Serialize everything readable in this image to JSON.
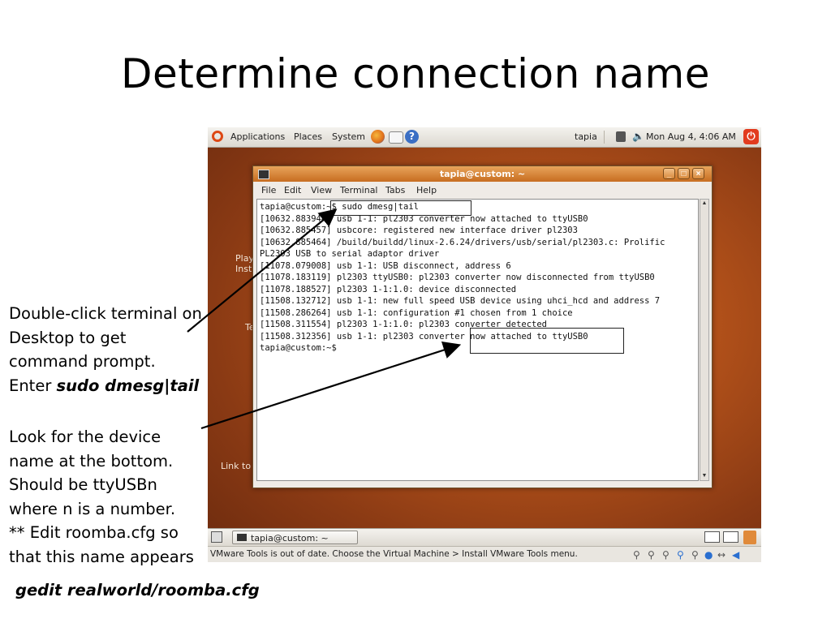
{
  "slide": {
    "title": "Determine connection name"
  },
  "top_panel": {
    "menus": [
      "Applications",
      "Places",
      "System"
    ],
    "user": "tapia",
    "clock": "Mon Aug  4,  4:06 AM",
    "icons": [
      "ubuntu-logo-icon",
      "firefox-icon",
      "mail-icon",
      "help-icon",
      "network-icon",
      "volume-icon",
      "power-icon"
    ]
  },
  "desktop": {
    "labels": [
      "Play",
      "Inst",
      "Te",
      "Link to"
    ]
  },
  "terminal": {
    "title": "tapia@custom: ~",
    "menu": [
      "File",
      "Edit",
      "View",
      "Terminal",
      "Tabs",
      "Help"
    ],
    "lines": [
      "tapia@custom:~$ sudo dmesg|tail",
      "[10632.883944] usb 1-1: pl2303 converter now attached to ttyUSB0",
      "[10632.885457] usbcore: registered new interface driver pl2303",
      "[10632.885464] /build/buildd/linux-2.6.24/drivers/usb/serial/pl2303.c: Prolific",
      "PL2303 USB to serial adaptor driver",
      "[11078.079008] usb 1-1: USB disconnect, address 6",
      "[11078.183119] pl2303 ttyUSB0: pl2303 converter now disconnected from ttyUSB0",
      "[11078.188527] pl2303 1-1:1.0: device disconnected",
      "[11508.132712] usb 1-1: new full speed USB device using uhci_hcd and address 7",
      "[11508.286264] usb 1-1: configuration #1 chosen from 1 choice",
      "[11508.311554] pl2303 1-1:1.0: pl2303 converter detected",
      "[11508.312356] usb 1-1: pl2303 converter now attached to ttyUSB0",
      "tapia@custom:~$"
    ]
  },
  "taskbar": {
    "task": "tapia@custom: ~"
  },
  "vmware": {
    "message": "VMware Tools is out of date. Choose the Virtual Machine > Install VMware Tools menu."
  },
  "annotations": {
    "note1": "Double-click terminal on\nDesktop to get\ncommand prompt.\nEnter ",
    "note1_cmd": "sudo dmesg|tail",
    "note2": "Look for the device\nname at the bottom.\nShould be ttyUSBn\nwhere n is a number.\n** Edit roomba.cfg so\nthat this name appears",
    "command": "gedit realworld/roomba.cfg"
  }
}
